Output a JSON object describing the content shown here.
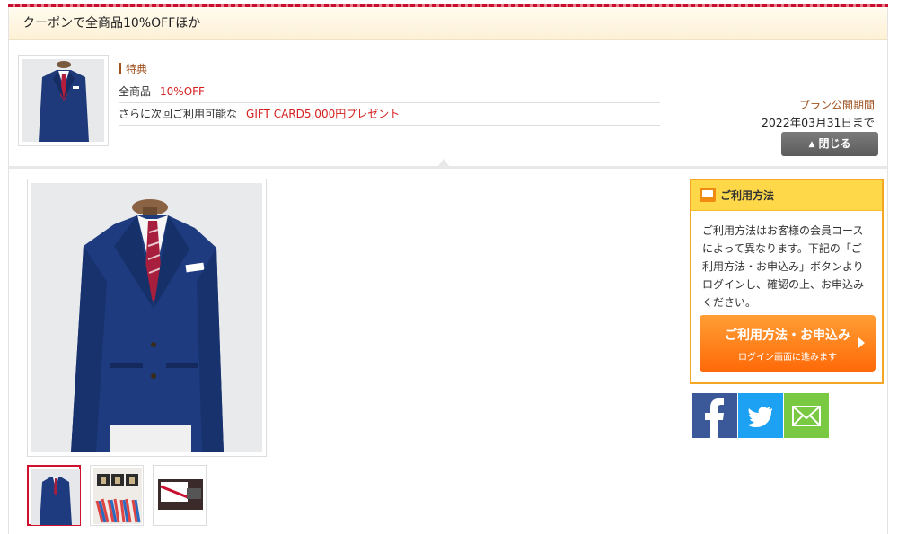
{
  "header": {
    "title": "クーポンで全商品10%OFFほか"
  },
  "summary": {
    "tokuten_label": "特典",
    "perks": [
      {
        "label": "全商品",
        "value": "10%OFF"
      },
      {
        "label": "さらに次回ご利用可能な",
        "value": "GIFT CARD5,000円プレゼント"
      }
    ],
    "period_label": "プラン公開期間",
    "period_date": "2022年03月31日まで",
    "close_label": "閉じる",
    "close_icon": "triangle-up-icon"
  },
  "usage": {
    "title": "ご利用方法",
    "title_icon": "monitor-icon",
    "text": "ご利用方法はお客様の会員コースによって異なります。下記の「ご利用方法・お申込み」ボタンよりログインし、確認の上、お申込みください。",
    "button_main": "ご利用方法・お申込み",
    "button_sub": "ログイン画面に進みます"
  },
  "social": [
    {
      "name": "facebook-icon",
      "color": "#3b5998"
    },
    {
      "name": "twitter-icon",
      "color": "#1da1f2"
    },
    {
      "name": "mail-icon",
      "color": "#7ac943"
    }
  ],
  "colors": {
    "accent_red": "#d51f1f",
    "brand_brown": "#a0521f",
    "usage_orange": "#ff7a10"
  }
}
